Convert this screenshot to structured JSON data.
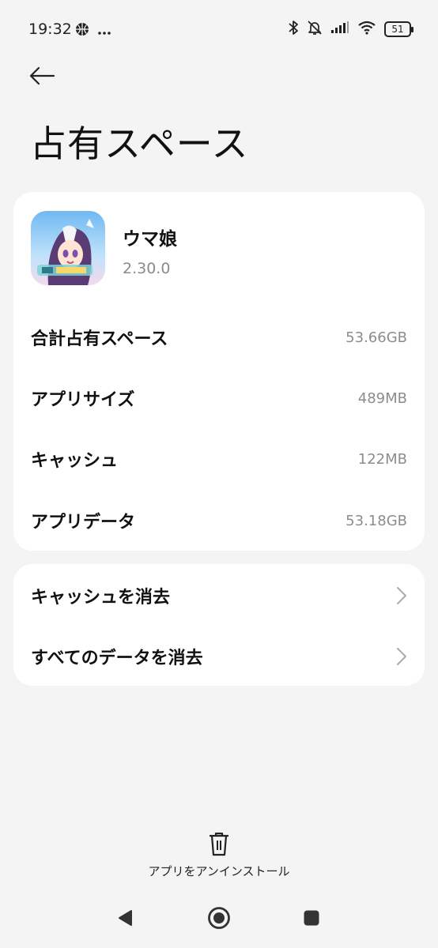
{
  "status_bar": {
    "time": "19:32",
    "left_icons": [
      "basketball-icon",
      "more-dots-icon"
    ],
    "right_icons": [
      "bluetooth-icon",
      "silent-bell-icon",
      "signal-icon",
      "wifi-icon"
    ],
    "battery": "51"
  },
  "header": {
    "title": "占有スペース"
  },
  "app": {
    "name": "ウマ娘",
    "version": "2.30.0",
    "icon": "app-icon"
  },
  "storage": {
    "rows": [
      {
        "label": "合計占有スペース",
        "value": "53.66GB"
      },
      {
        "label": "アプリサイズ",
        "value": "489MB"
      },
      {
        "label": "キャッシュ",
        "value": "122MB"
      },
      {
        "label": "アプリデータ",
        "value": "53.18GB"
      }
    ]
  },
  "actions": {
    "clear_cache": "キャッシュを消去",
    "clear_all_data": "すべてのデータを消去"
  },
  "footer": {
    "uninstall_label": "アプリをアンインストール"
  },
  "colors": {
    "background": "#f4f4f4",
    "card": "#ffffff",
    "secondary_text": "#8c8c8c"
  }
}
